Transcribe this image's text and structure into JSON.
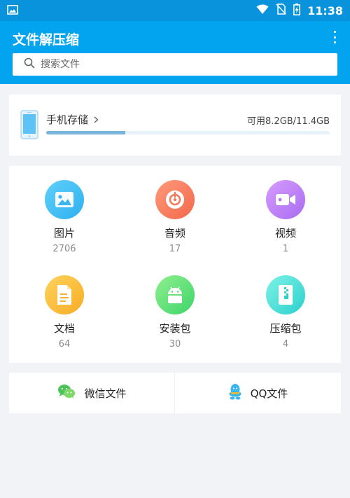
{
  "status_bar": {
    "time": "11:38",
    "icons": [
      "image-icon",
      "wifi-icon",
      "no-sim-icon",
      "battery-charging-icon"
    ]
  },
  "app_bar": {
    "title": "文件解压缩",
    "menu_icon": "more-vert-icon"
  },
  "search": {
    "placeholder": "搜索文件",
    "value": ""
  },
  "storage": {
    "label": "手机存储",
    "usage": "可用8.2GB/11.4GB",
    "used_fraction": 0.28
  },
  "categories": [
    {
      "name": "图片",
      "count": "2706",
      "icon": "image-icon",
      "color_from": "#5fd0fb",
      "color_to": "#2fb0ef"
    },
    {
      "name": "音频",
      "count": "17",
      "icon": "music-disc-icon",
      "color_from": "#ff9a7a",
      "color_to": "#f2684c"
    },
    {
      "name": "视频",
      "count": "1",
      "icon": "video-camera-icon",
      "color_from": "#d79bff",
      "color_to": "#a86cf0"
    },
    {
      "name": "文档",
      "count": "64",
      "icon": "document-icon",
      "color_from": "#ffd25c",
      "color_to": "#f7ad25"
    },
    {
      "name": "安装包",
      "count": "30",
      "icon": "android-icon",
      "color_from": "#8ff08d",
      "color_to": "#3ed46a"
    },
    {
      "name": "压缩包",
      "count": "4",
      "icon": "archive-icon",
      "color_from": "#7ff2e6",
      "color_to": "#2ad0cc"
    }
  ],
  "social": [
    {
      "label": "微信文件",
      "icon": "wechat-icon"
    },
    {
      "label": "QQ文件",
      "icon": "qq-icon"
    }
  ]
}
